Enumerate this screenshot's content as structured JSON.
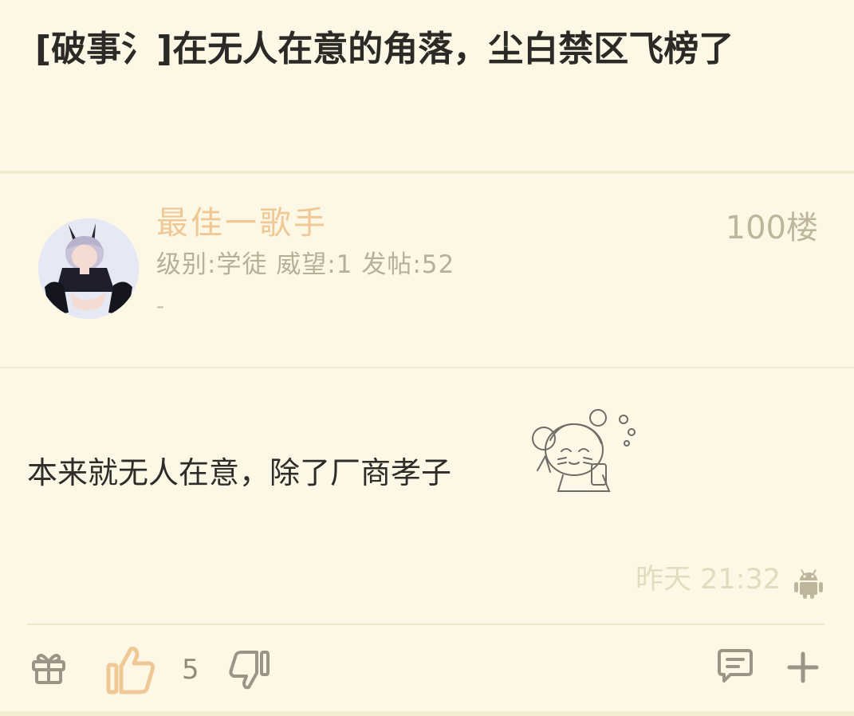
{
  "thread": {
    "title": "[破事氵]在无人在意的角落，尘白禁区飞榜了"
  },
  "post": {
    "author": {
      "name": "最佳一歌手",
      "stats": "级别:学徒 威望:1 发帖:52",
      "extra": "-"
    },
    "floor": "100楼",
    "content": "本来就无人在意，除了厂商孝子",
    "time": "昨天 21:32",
    "client_icon": "android-icon"
  },
  "actions": {
    "like_count": "5",
    "icons": [
      "gift-icon",
      "thumbs-up-icon",
      "thumbs-down-icon",
      "comment-icon",
      "plus-icon"
    ]
  },
  "colors": {
    "background": "#fdf8e6",
    "username": "#f0c896",
    "like_active": "#f0c896",
    "muted": "#bdb69c"
  }
}
